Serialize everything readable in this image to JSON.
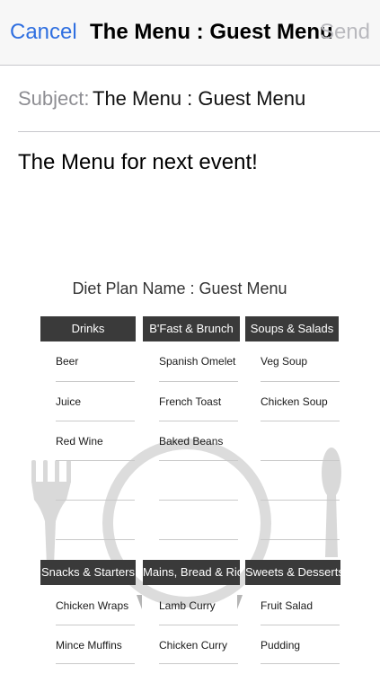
{
  "navbar": {
    "cancel_label": "Cancel",
    "title": "The Menu : Guest Menu",
    "send_label": "Send"
  },
  "subject": {
    "label": "Subject:",
    "value": "The Menu : Guest Menu"
  },
  "message": {
    "body": "The Menu for next event!"
  },
  "menu_image": {
    "plan_title": "Diet Plan Name : Guest Menu",
    "top_sections": [
      {
        "header": "Drinks",
        "items": [
          "Beer",
          "Juice",
          "Red Wine"
        ]
      },
      {
        "header": "B'Fast & Brunch",
        "items": [
          "Spanish Omelet",
          "French Toast",
          "Baked Beans"
        ]
      },
      {
        "header": "Soups & Salads",
        "items": [
          "Veg Soup",
          "Chicken Soup",
          ""
        ]
      }
    ],
    "bottom_sections": [
      {
        "header": "Snacks & Starters",
        "items": [
          "Chicken Wraps",
          "Mince Muffins"
        ]
      },
      {
        "header": "Mains, Bread & Rice",
        "items": [
          "Lamb Curry",
          "Chicken Curry"
        ]
      },
      {
        "header": "Sweets & Desserts",
        "items": [
          "Fruit Salad",
          "Pudding"
        ]
      }
    ],
    "colors": {
      "header_bg": "#3a3a3a",
      "header_text": "#ffffff",
      "link": "#2f6fe0"
    }
  }
}
